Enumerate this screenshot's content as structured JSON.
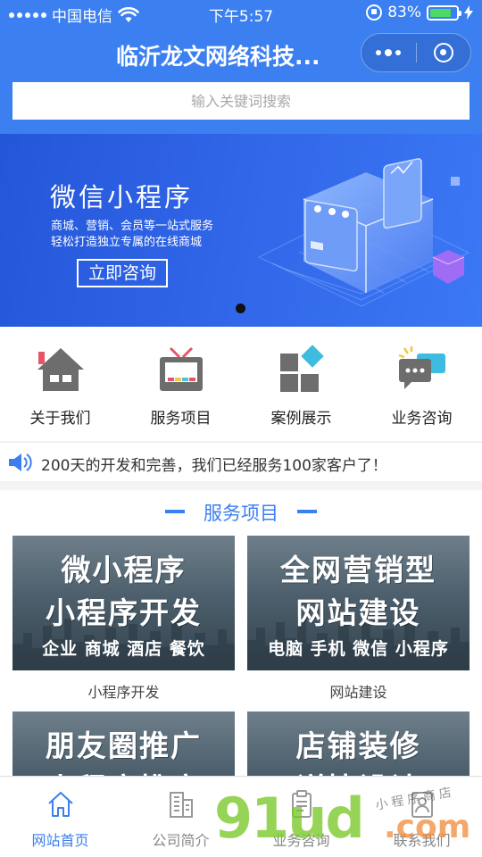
{
  "status_bar": {
    "carrier": "中国电信",
    "time": "下午5:57",
    "battery_percent": "83%",
    "battery_level": 0.83
  },
  "nav": {
    "title": "临沂龙文网络科技..."
  },
  "search": {
    "placeholder": "输入关键词搜索"
  },
  "banner": {
    "title": "微信小程序",
    "subtitle_line1": "商城、营销、会员等一站式服务",
    "subtitle_line2": "轻松打造独立专属的在线商城",
    "button": "立即咨询",
    "slide_count": 1,
    "active_slide": 1
  },
  "quick_menu": [
    {
      "label": "关于我们",
      "icon": "home-icon"
    },
    {
      "label": "服务项目",
      "icon": "tv-icon"
    },
    {
      "label": "案例展示",
      "icon": "blocks-icon"
    },
    {
      "label": "业务咨询",
      "icon": "chat-icon"
    }
  ],
  "notice": {
    "text": "200天的开发和完善，我们已经服务100家客户了！",
    "icon": "speaker-icon"
  },
  "services": {
    "title": "服务项目",
    "items": [
      {
        "line1": "微小程序",
        "line2": "小程序开发",
        "line3": "企业 商城  酒店 餐饮",
        "caption": "小程序开发"
      },
      {
        "line1": "全网营销型",
        "line2": "网站建设",
        "line3": "电脑 手机 微信 小程序",
        "caption": "网站建设"
      },
      {
        "line1": "朋友圈推广",
        "line2": "小程序推广"
      },
      {
        "line1": "店铺装修",
        "line2": "详情设计"
      }
    ]
  },
  "tabbar": [
    {
      "label": "网站首页",
      "icon": "home-outline-icon",
      "active": true
    },
    {
      "label": "公司简介",
      "icon": "building-icon",
      "active": false
    },
    {
      "label": "业务咨询",
      "icon": "clipboard-icon",
      "active": false
    },
    {
      "label": "联系我们",
      "icon": "contact-icon",
      "active": false
    }
  ],
  "watermark": {
    "brand": "91ud",
    "domain": ".com",
    "tagline": "小程序商店"
  },
  "colors": {
    "primary": "#3b7ff0",
    "banner": "#2f63e6",
    "watermark_green": "#78c828",
    "watermark_orange": "#f08228"
  }
}
